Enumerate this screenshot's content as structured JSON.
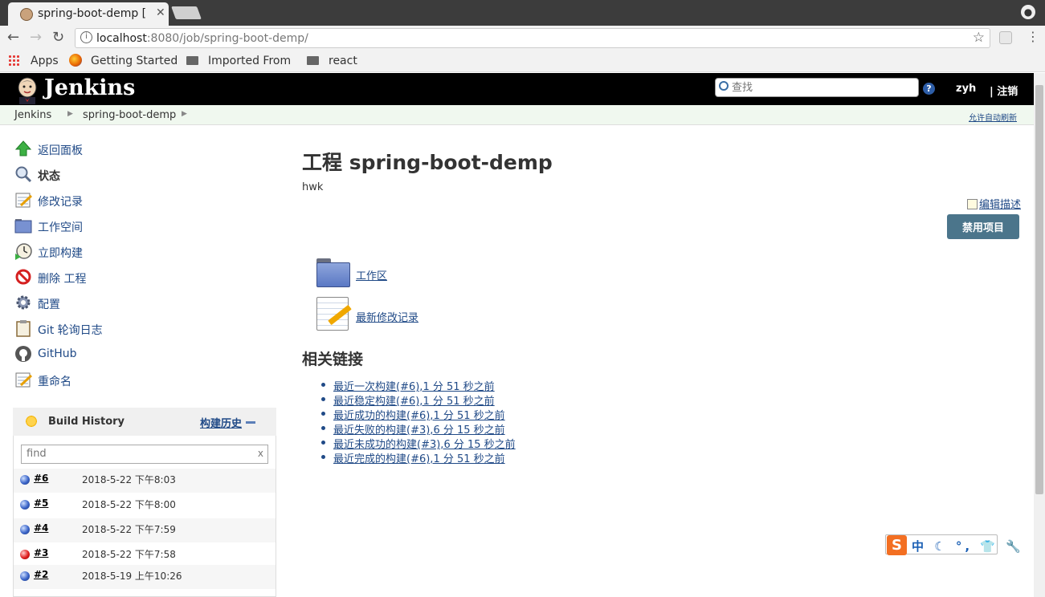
{
  "browser": {
    "tab_title": "spring-boot-demp [",
    "tab_close": "✕",
    "url_host": "localhost",
    "url_path": ":8080/job/spring-boot-demp/",
    "bookmarks": {
      "apps": "Apps",
      "getting_started": "Getting Started",
      "imported_from": "Imported From",
      "react": "react"
    }
  },
  "header": {
    "logo_text": "Jenkins",
    "search_placeholder": "查找",
    "help": "?",
    "user": "zyh",
    "logout": "| 注销"
  },
  "breadcrumb": {
    "items": [
      "Jenkins",
      "spring-boot-demp"
    ],
    "auto_refresh": "允许自动刷新"
  },
  "sidebar": {
    "tasks": [
      {
        "label": "返回面板",
        "icon": "up-arrow-icon"
      },
      {
        "label": "状态",
        "icon": "search-icon"
      },
      {
        "label": "修改记录",
        "icon": "notepad-icon"
      },
      {
        "label": "工作空间",
        "icon": "folder-icon"
      },
      {
        "label": "立即构建",
        "icon": "clock-icon"
      },
      {
        "label": "删除 工程",
        "icon": "no-entry-icon"
      },
      {
        "label": "配置",
        "icon": "gear-icon"
      },
      {
        "label": "Git 轮询日志",
        "icon": "clipboard-icon"
      },
      {
        "label": "GitHub",
        "icon": "github-icon"
      },
      {
        "label": "重命名",
        "icon": "notepad-icon"
      }
    ]
  },
  "build_history": {
    "title": "Build History",
    "link": "构建历史",
    "filter_placeholder": "find",
    "filter_clear": "x",
    "builds": [
      {
        "num": "#6",
        "date": "2018-5-22 下午8:03",
        "status": "blue"
      },
      {
        "num": "#5",
        "date": "2018-5-22 下午8:00",
        "status": "blue"
      },
      {
        "num": "#4",
        "date": "2018-5-22 下午7:59",
        "status": "blue"
      },
      {
        "num": "#3",
        "date": "2018-5-22 下午7:58",
        "status": "red"
      },
      {
        "num": "#2",
        "date": "2018-5-19 上午10:26",
        "status": "blue"
      }
    ]
  },
  "main": {
    "title": "工程 spring-boot-demp",
    "description": "hwk",
    "edit_description": "编辑描述",
    "disable_button": "禁用项目",
    "workspace_link": "工作区",
    "changes_link": "最新修改记录",
    "related_title": "相关链接",
    "permalinks": [
      "最近一次构建(#6),1 分 51 秒之前",
      "最近稳定构建(#6),1 分 51 秒之前",
      "最近成功的构建(#6),1 分 51 秒之前",
      "最近失败的构建(#3),6 分 15 秒之前",
      "最近未成功的构建(#3),6 分 15 秒之前",
      "最近完成的构建(#6),1 分 51 秒之前"
    ]
  },
  "ime": {
    "logo": "S",
    "text": "中 ☾ °, 👕 🔧"
  },
  "colors": {
    "link": "#204a87",
    "header_bg": "#000000",
    "breadcrumb_bg": "#f0f8ef",
    "disable_button_bg": "#4b758b"
  }
}
